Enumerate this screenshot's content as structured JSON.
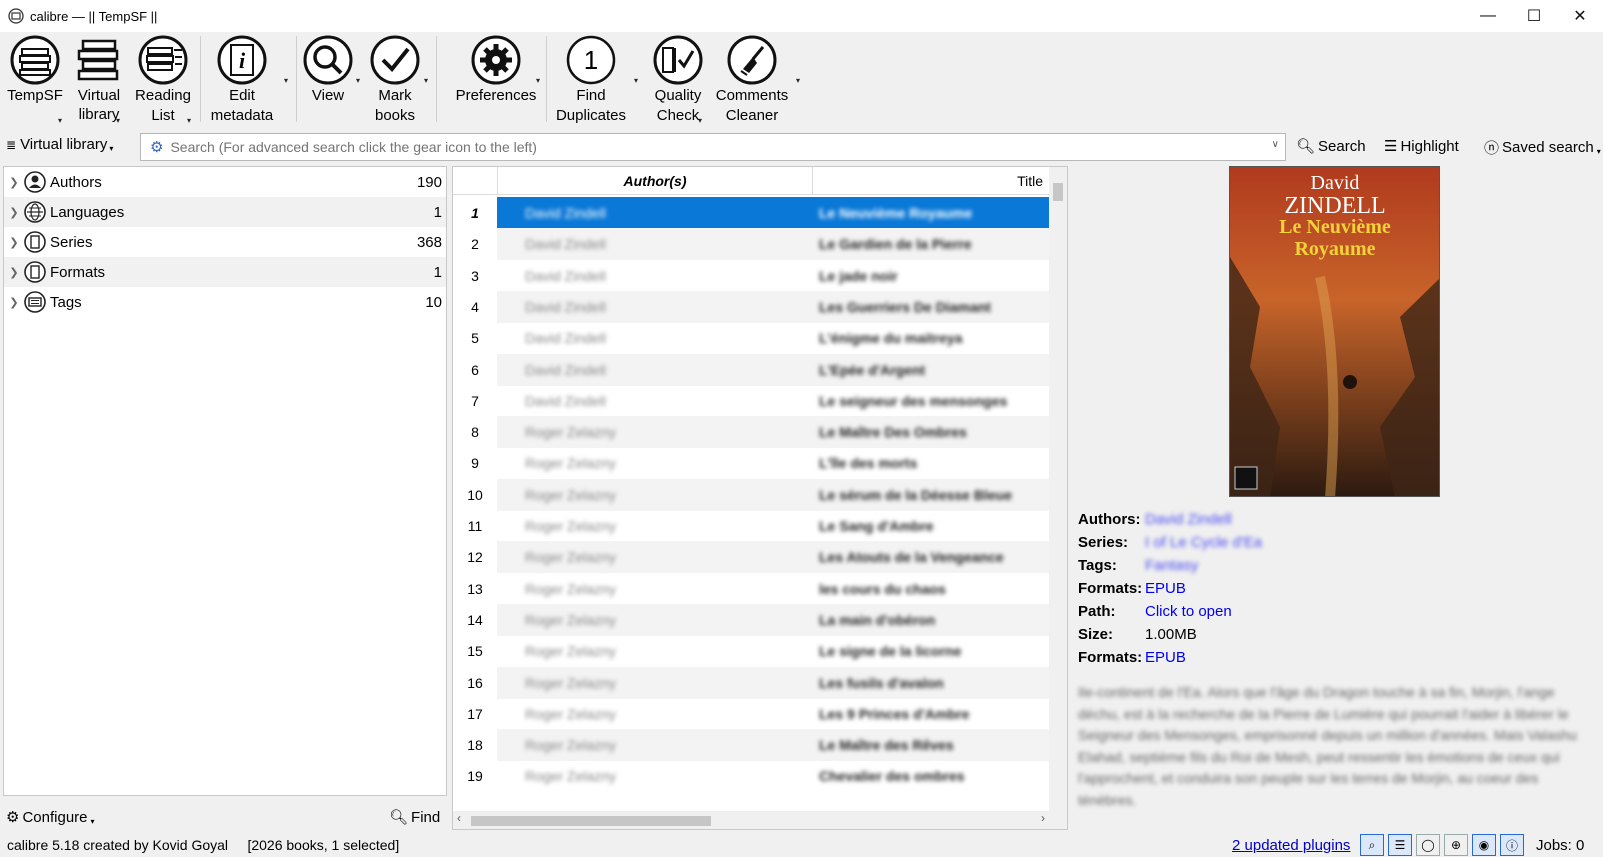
{
  "window": {
    "title": "calibre — || TempSF ||"
  },
  "toolbar": {
    "tempsf": "TempSF",
    "virtual_library_1": "Virtual",
    "virtual_library_2": "library",
    "reading_list_1": "Reading",
    "reading_list_2": "List",
    "edit_metadata_1": "Edit",
    "edit_metadata_2": "metadata",
    "view": "View",
    "mark_books_1": "Mark",
    "mark_books_2": "books",
    "preferences": "Preferences",
    "find_duplicates_1": "Find",
    "find_duplicates_2": "Duplicates",
    "quality_check_1": "Quality",
    "quality_check_2": "Check",
    "comments_cleaner_1": "Comments",
    "comments_cleaner_2": "Cleaner"
  },
  "searchbar": {
    "virtual_library": "Virtual library",
    "placeholder": "Search (For advanced search click the gear icon to the left)",
    "search": "Search",
    "highlight": "Highlight",
    "saved_search": "Saved search"
  },
  "tag_browser": {
    "items": [
      {
        "label": "Authors",
        "count": "190"
      },
      {
        "label": "Languages",
        "count": "1"
      },
      {
        "label": "Series",
        "count": "368"
      },
      {
        "label": "Formats",
        "count": "1"
      },
      {
        "label": "Tags",
        "count": "10"
      }
    ],
    "configure": "Configure",
    "find": "Find"
  },
  "book_list": {
    "columns": {
      "authors": "Author(s)",
      "title": "Title"
    },
    "rows": [
      {
        "n": "1",
        "author": "David Zindell",
        "title": "Le Neuvième Royaume"
      },
      {
        "n": "2",
        "author": "David Zindell",
        "title": "Le Gardien de la Pierre"
      },
      {
        "n": "3",
        "author": "David Zindell",
        "title": "Le jade noir"
      },
      {
        "n": "4",
        "author": "David Zindell",
        "title": "Les Guerriers De Diamant"
      },
      {
        "n": "5",
        "author": "David Zindell",
        "title": "L'énigme du maitreya"
      },
      {
        "n": "6",
        "author": "David Zindell",
        "title": "L'Epée d'Argent"
      },
      {
        "n": "7",
        "author": "David Zindell",
        "title": "Le seigneur des mensonges"
      },
      {
        "n": "8",
        "author": "Roger Zelazny",
        "title": "Le Maître Des Ombres"
      },
      {
        "n": "9",
        "author": "Roger Zelazny",
        "title": "L'île des morts"
      },
      {
        "n": "10",
        "author": "Roger Zelazny",
        "title": "Le sérum de la Déesse Bleue"
      },
      {
        "n": "11",
        "author": "Roger Zelazny",
        "title": "Le Sang d'Ambre"
      },
      {
        "n": "12",
        "author": "Roger Zelazny",
        "title": "Les Atouts de la Vengeance"
      },
      {
        "n": "13",
        "author": "Roger Zelazny",
        "title": "les cours du chaos"
      },
      {
        "n": "14",
        "author": "Roger Zelazny",
        "title": "La main d'obéron"
      },
      {
        "n": "15",
        "author": "Roger Zelazny",
        "title": "Le signe de la licorne"
      },
      {
        "n": "16",
        "author": "Roger Zelazny",
        "title": "Les fusils d'avalon"
      },
      {
        "n": "17",
        "author": "Roger Zelazny",
        "title": "Les 9 Princes d'Ambre"
      },
      {
        "n": "18",
        "author": "Roger Zelazny",
        "title": "Le Maître des Rêves"
      },
      {
        "n": "19",
        "author": "Roger Zelazny",
        "title": "Chevalier des ombres"
      }
    ]
  },
  "cover": {
    "author": "David",
    "author2": "ZINDELL",
    "title1": "Le Neuvième",
    "title2": "Royaume"
  },
  "details": {
    "authors_k": "Authors:",
    "authors_v": "David Zindell",
    "series_k": "Series:",
    "series_v": "I of Le Cycle d'Ea",
    "tags_k": "Tags:",
    "tags_v": "Fantasy",
    "formats_k": "Formats:",
    "formats_v": "EPUB",
    "path_k": "Path:",
    "path_v": "Click to open",
    "size_k": "Size:",
    "size_v": "1.00MB",
    "formats2_k": "Formats:",
    "formats2_v": "EPUB",
    "comments": "Ile-continent de l'Ea. Alors que l'âge du Dragon touche à sa fin, Morjin, l'ange déchu, est à la recherche de la Pierre de Lumière qui pourrait l'aider à libérer le Seigneur des Mensonges, emprisonné depuis un million d'années. Mais Valashu Elahad, septième fils du Roi de Mesh, peut ressentir les émotions de ceux qui l'approchent, et conduira son peuple sur les terres de Morjin, au coeur des ténèbres."
  },
  "status": {
    "left": "calibre 5.18 created by Kovid Goyal     [2026 books, 1 selected]",
    "plugins": "2 updated plugins",
    "jobs": "Jobs: 0"
  }
}
